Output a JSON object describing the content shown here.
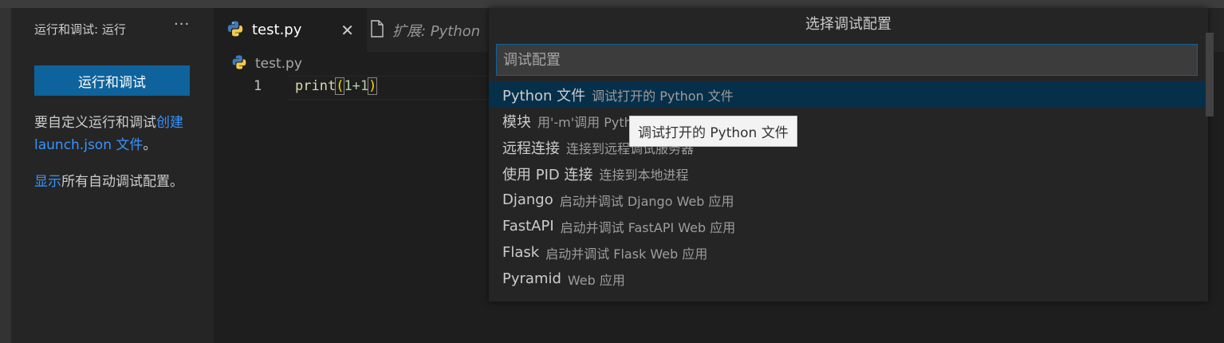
{
  "sidebar": {
    "title": "运行和调试: 运行",
    "more": "···",
    "run_button": "运行和调试",
    "help_prefix": "要自定义运行和调试",
    "help_link": "创建 launch.json 文件",
    "help_suffix": "。",
    "show_link": "显示",
    "show_suffix": "所有自动调试配置。"
  },
  "tabs": [
    {
      "label": "test.py",
      "icon": "python-icon",
      "active": true,
      "close": "✕"
    },
    {
      "label": "扩展: Python",
      "icon": "file-icon",
      "active": false
    }
  ],
  "breadcrumb": {
    "file": "test.py"
  },
  "editor": {
    "line_number": "1",
    "code": {
      "fn": "print",
      "open": "(",
      "args": "1+1",
      "close": ")"
    }
  },
  "quick_pick": {
    "title": "选择调试配置",
    "placeholder": "调试配置",
    "items": [
      {
        "label": "Python 文件",
        "description": "调试打开的 Python 文件",
        "selected": true
      },
      {
        "label": "模块",
        "description": "用'-m'调用 Python 模块来调试"
      },
      {
        "label": "远程连接",
        "description": "连接到远程调试服务器"
      },
      {
        "label": "使用 PID 连接",
        "description": "连接到本地进程"
      },
      {
        "label": "Django",
        "description": "启动并调试 Django Web 应用"
      },
      {
        "label": "FastAPI",
        "description": "启动并调试 FastAPI Web 应用"
      },
      {
        "label": "Flask",
        "description": "启动并调试 Flask Web 应用"
      },
      {
        "label": "Pyramid",
        "description": "Web 应用"
      }
    ]
  },
  "tooltip": "调试打开的 Python 文件",
  "colors": {
    "accent": "#0e639c",
    "link": "#3794ff",
    "selection": "#062f4a",
    "editor_bg": "#1e1e1e",
    "sidebar_bg": "#252526"
  }
}
